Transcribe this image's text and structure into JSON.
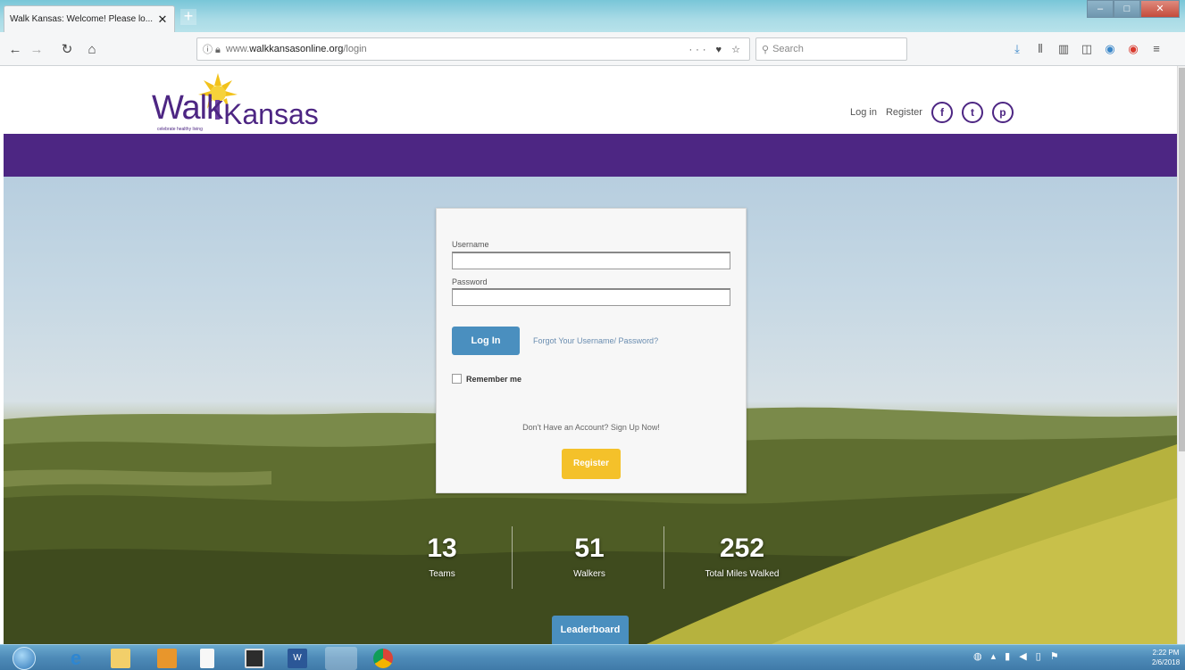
{
  "browser": {
    "tab_title": "Walk Kansas: Welcome! Please lo...",
    "tab_close": "✕",
    "new_tab": "+",
    "url_prefix": "www.",
    "url_domain": "walkkansasonline.org",
    "url_path": "/login",
    "url_actions": "··· ♥ ☆",
    "search_placeholder": "Search",
    "window_controls": {
      "minimize": "–",
      "maximize": "□",
      "close": "✕"
    }
  },
  "site": {
    "logo_walk": "Walk",
    "logo_kansas": "Kansas",
    "logo_tagline": "celebrate healthy living",
    "header_links": {
      "login": "Log in",
      "register": "Register"
    },
    "social": {
      "facebook": "f",
      "twitter": "t",
      "pinterest": "p"
    }
  },
  "login_form": {
    "username_label": "Username",
    "password_label": "Password",
    "login_button": "Log In",
    "forgot_link": "Forgot Your Username/ Password?",
    "remember_label": "Remember me",
    "no_account_text": "Don't Have an Account? Sign Up Now!",
    "register_button": "Register"
  },
  "stats": [
    {
      "value": "13",
      "label": "Teams"
    },
    {
      "value": "51",
      "label": "Walkers"
    },
    {
      "value": "252",
      "label": "Total Miles Walked"
    }
  ],
  "leaderboard_button": "Leaderboard",
  "taskbar": {
    "clock_time": "2:22 PM",
    "clock_date": "2/6/2018"
  },
  "colors": {
    "brand_purple": "#4d2683",
    "login_blue": "#4a8fbf",
    "register_yellow": "#f4c12a"
  }
}
